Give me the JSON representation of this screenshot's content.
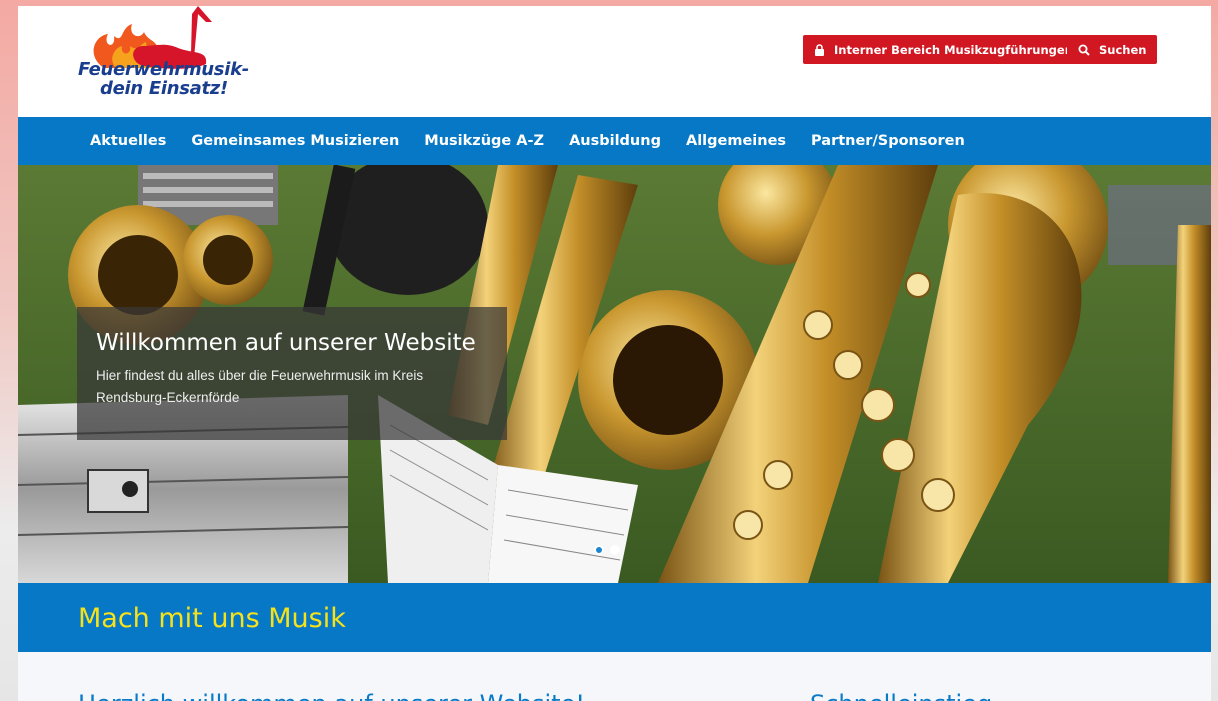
{
  "header": {
    "logo_line1": "Feuerwehrmusik-",
    "logo_line2": "dein Einsatz!",
    "intern_button": "Interner Bereich Musikzugführungen",
    "search_button": "Suchen"
  },
  "nav": {
    "items": [
      "Aktuelles",
      "Gemeinsames Musizieren",
      "Musikzüge A-Z",
      "Ausbildung",
      "Allgemeines",
      "Partner/Sponsoren"
    ]
  },
  "hero": {
    "title": "Willkommen auf unserer Website",
    "text": "Hier findest du alles über die Feuerwehrmusik im Kreis Rendsburg-Eckernförde",
    "slides": 2,
    "active_slide": 1
  },
  "banner": {
    "title": "Mach mit uns Musik"
  },
  "content": {
    "welcome_heading": "Herzlich willkommen auf unserer Website!",
    "quick_heading": "Schnelleinstieg"
  },
  "colors": {
    "nav_blue": "#0678c5",
    "accent_red": "#d01722",
    "banner_yellow": "#f6e21b",
    "heading_blue": "#0a7bc8",
    "logo_blue": "#1a3e8e"
  },
  "icons": {
    "intern": "lock-icon",
    "search": "search-icon",
    "logo": "flame-music-note-icon"
  }
}
